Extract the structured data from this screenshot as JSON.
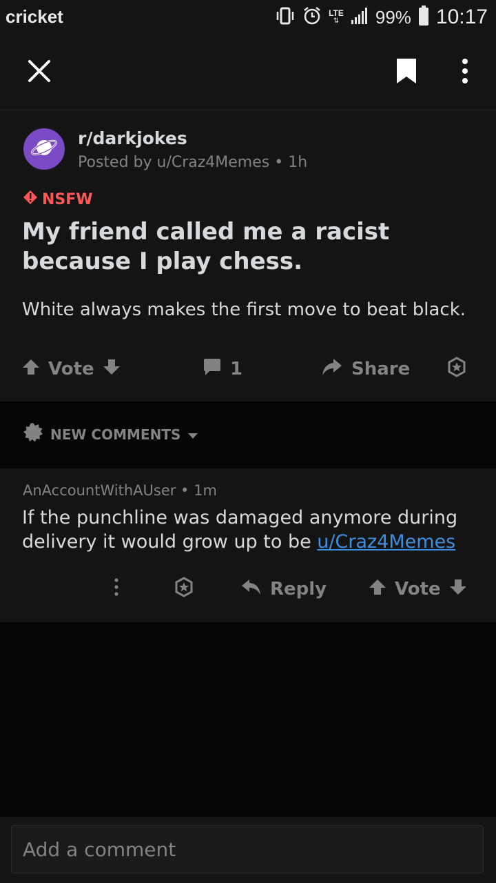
{
  "status_bar": {
    "carrier": "cricket",
    "network": "LTE",
    "battery": "99%",
    "time": "10:17"
  },
  "toolbar": {
    "close_icon": "close-icon",
    "bookmark_icon": "bookmark-icon",
    "more_icon": "more-vertical-icon"
  },
  "post": {
    "subreddit": "r/darkjokes",
    "posted_by": "Posted by u/Craz4Memes • 1h",
    "nsfw_label": "NSFW",
    "title": "My friend called me a racist because I play chess.",
    "body": "White always makes the first move to beat black.",
    "vote_label": "Vote",
    "comment_count": "1",
    "share_label": "Share"
  },
  "sort": {
    "label": "NEW COMMENTS"
  },
  "comment": {
    "meta": "AnAccountWithAUser • 1m",
    "body_text": "If the punchline was damaged anymore during delivery it would grow up to be ",
    "body_link": "u/Craz4Memes",
    "reply_label": "Reply",
    "vote_label": "Vote"
  },
  "composer": {
    "placeholder": "Add a comment"
  },
  "colors": {
    "background": "#050505",
    "surface": "#141414",
    "text": "#d7dadc",
    "muted": "#818384",
    "nsfw": "#ff585b",
    "link": "#3d8ee0",
    "avatar": "#7a4bc4"
  }
}
